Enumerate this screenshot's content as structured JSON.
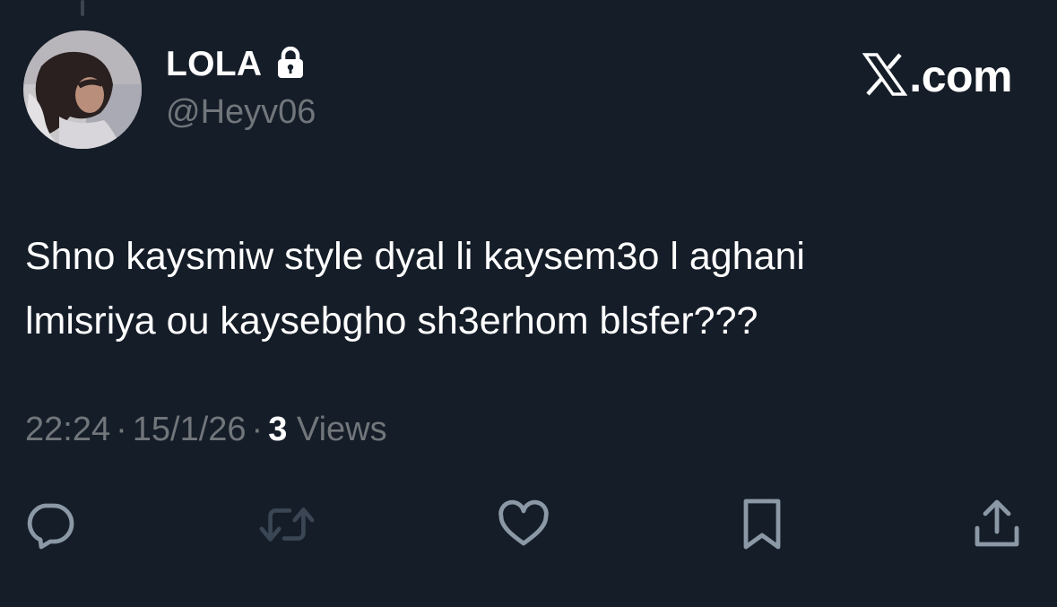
{
  "tweet": {
    "author": {
      "display_name": "LOLA",
      "handle": "@Heyv06",
      "protected_icon": "lock-icon",
      "avatar_icon": "avatar"
    },
    "brand": {
      "logo_icon": "x-logo-icon",
      "text": ".com"
    },
    "text_line1": "Shno kaysmiw style dyal li kaysem3o l aghani",
    "text_line2": "lmisriya ou kaysebgho sh3erhom blsfer???",
    "time": "22:24",
    "date": "15/1/26",
    "separator": "·",
    "views_count": "3",
    "views_label": "Views",
    "actions": [
      {
        "name": "reply",
        "icon": "reply-icon"
      },
      {
        "name": "retweet",
        "icon": "retweet-icon"
      },
      {
        "name": "like",
        "icon": "heart-icon"
      },
      {
        "name": "bookmark",
        "icon": "bookmark-icon"
      },
      {
        "name": "share",
        "icon": "share-icon"
      }
    ]
  },
  "colors": {
    "background": "#151d28",
    "primary_text": "#ffffff",
    "secondary_text": "#71767b",
    "icon": "#8b98a5"
  }
}
